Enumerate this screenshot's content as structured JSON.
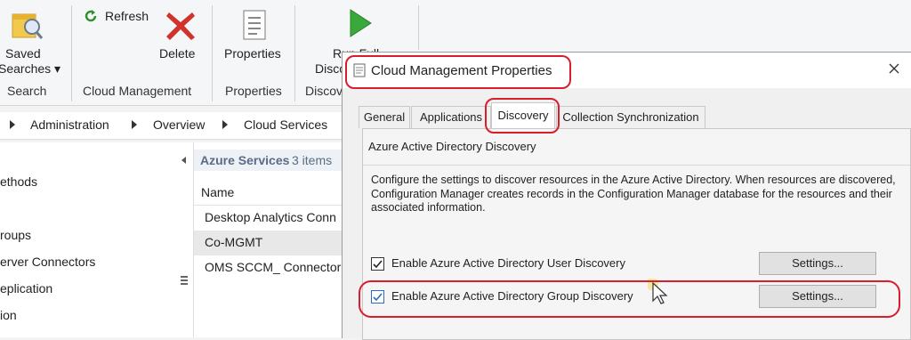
{
  "ribbon": {
    "saved_searches_line1": "Saved",
    "saved_searches_line2": "Searches ▾",
    "refresh": "Refresh",
    "delete": "Delete",
    "properties": "Properties",
    "run_full_line1": "Run Full",
    "run_full_line2": "Disco",
    "groups": {
      "search": "Search",
      "cloud_management": "Cloud Management",
      "properties": "Properties",
      "discovery": "Discov"
    }
  },
  "breadcrumb": {
    "items": [
      "Administration",
      "Overview",
      "Cloud Services"
    ]
  },
  "nav": {
    "items": [
      "ethods",
      "roups",
      "erver Connectors",
      "eplication",
      "ion"
    ]
  },
  "list": {
    "title": "Azure Services",
    "count": "3 items",
    "column_name": "Name",
    "rows": [
      "Desktop Analytics Conn",
      "Co-MGMT",
      "OMS SCCM_ Connector"
    ]
  },
  "dialog": {
    "title": "Cloud Management Properties",
    "tabs": [
      "General",
      "Applications",
      "Discovery",
      "Collection Synchronization"
    ],
    "active_tab": "Discovery",
    "section_title": "Azure Active Directory Discovery",
    "description": "Configure the settings to discover resources in the Azure Active Directory. When resources are discovered, Configuration Manager creates records in the Configuration Manager database for the resources and their associated information.",
    "user_discovery": {
      "label": "Enable Azure Active Directory User Discovery",
      "checked": true,
      "button": "Settings..."
    },
    "group_discovery": {
      "label": "Enable Azure Active Directory Group Discovery",
      "checked": true,
      "button": "Settings..."
    }
  },
  "colors": {
    "highlight": "#d81d2b",
    "delete_icon": "#d0322c",
    "run_icon": "#3aa83a"
  }
}
